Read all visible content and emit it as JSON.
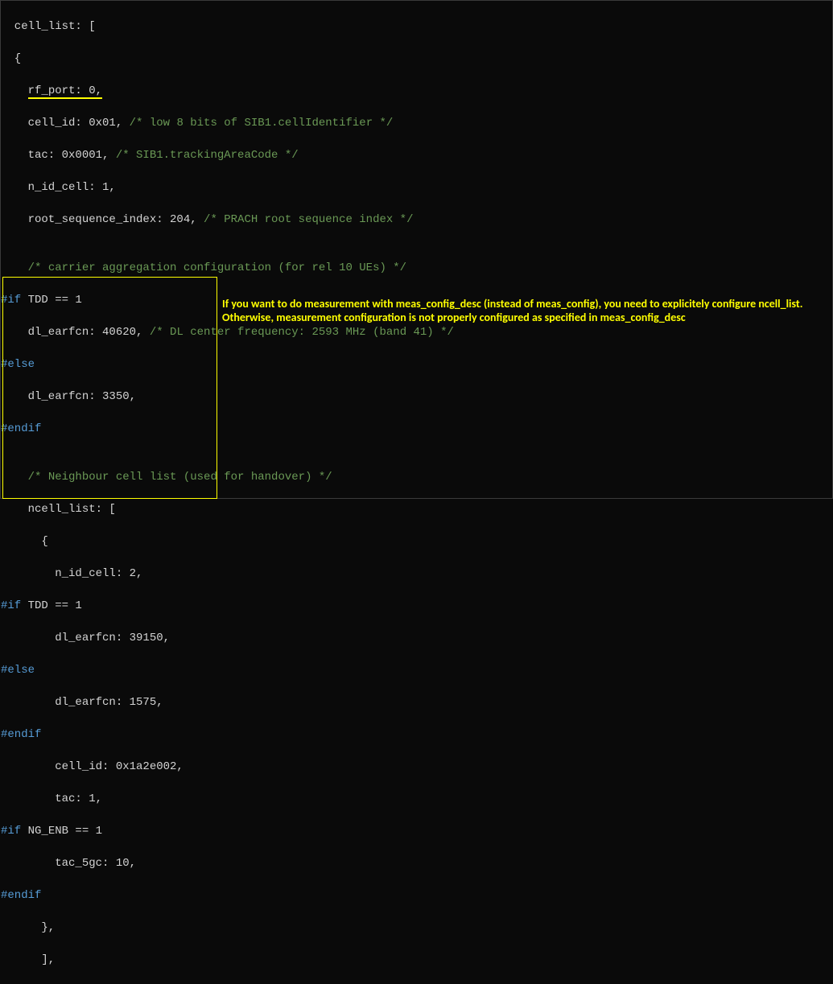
{
  "code": {
    "l1": "  cell_list: [",
    "l2": "  {",
    "l3a": "    ",
    "l3b": "rf_port: 0,",
    "l4a": "    cell_id: 0x01, ",
    "l4b": "/* low 8 bits of SIB1.cellIdentifier */",
    "l5a": "    tac: 0x0001, ",
    "l5b": "/* SIB1.trackingAreaCode */",
    "l6": "    n_id_cell: 1,",
    "l7a": "    root_sequence_index: 204, ",
    "l7b": "/* PRACH root sequence index */",
    "l8": "",
    "l9a": "    ",
    "l9b": "/* carrier aggregation configuration (for rel 10 UEs) */",
    "l10a": "#if",
    "l10b": " TDD == 1",
    "l11a": "    dl_earfcn: 40620, ",
    "l11b": "/* DL center frequency: 2593 MHz (band 41) */",
    "l12": "#else",
    "l13": "    dl_earfcn: 3350,",
    "l14": "#endif",
    "l15": "",
    "l16a": "    ",
    "l16b": "/* Neighbour cell list (used for handover) */",
    "l17": "    ncell_list: [",
    "l18": "      {",
    "l19": "        n_id_cell: 2,",
    "l20a": "#if",
    "l20b": " TDD == 1",
    "l21": "        dl_earfcn: 39150,",
    "l22": "#else",
    "l23": "        dl_earfcn: 1575,",
    "l24": "#endif",
    "l25": "        cell_id: 0x1a2e002,",
    "l26": "        tac: 1,",
    "l27a": "#if",
    "l27b": " NG_ENB == 1",
    "l28": "        tac_5gc: 10,",
    "l29": "#endif",
    "l30": "      },",
    "l31": "      ],"
  },
  "annotation": "If you want to do measurement with meas_config_desc (instead of meas_config), you need to explicitely configure ncell_list. Otherwise, measurement configuration is not properly configured as specified in meas_config_desc"
}
